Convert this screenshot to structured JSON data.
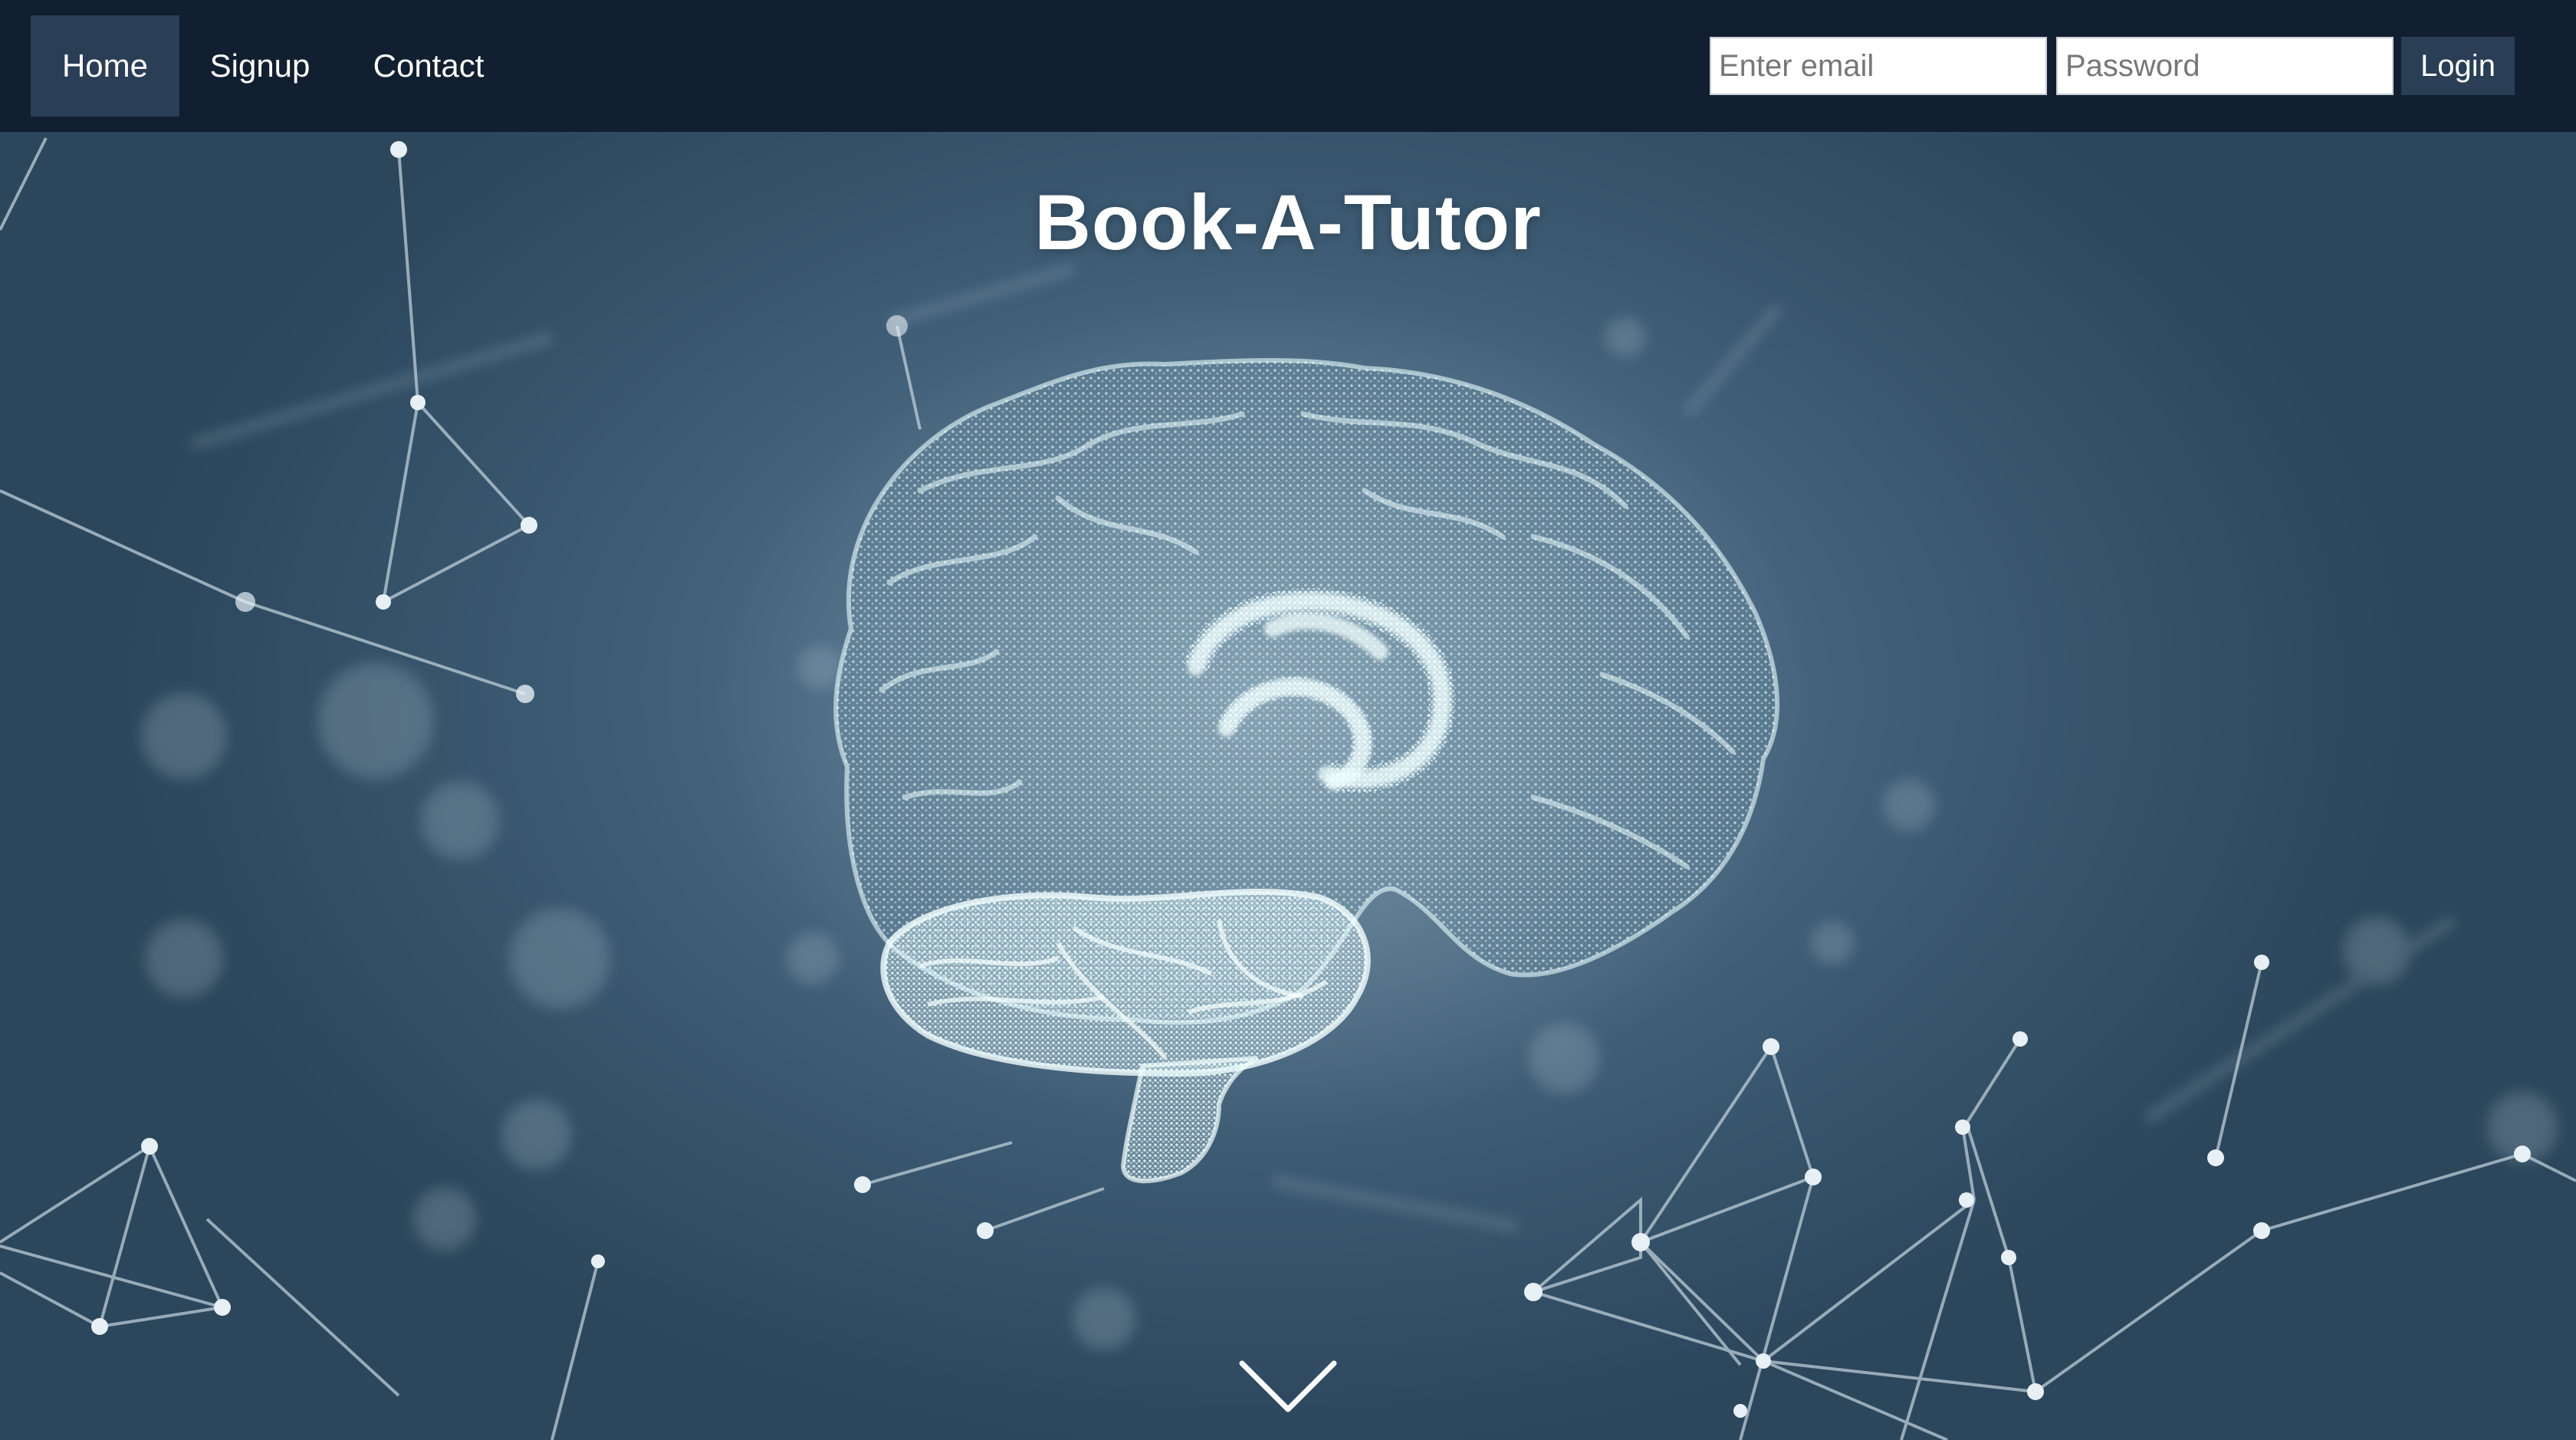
{
  "navbar": {
    "items": [
      {
        "label": "Home",
        "active": true
      },
      {
        "label": "Signup",
        "active": false
      },
      {
        "label": "Contact",
        "active": false
      }
    ],
    "login_form": {
      "email_placeholder": "Enter email",
      "password_placeholder": "Password",
      "login_label": "Login"
    }
  },
  "hero": {
    "title": "Book-A-Tutor",
    "background_image": "glowing-particle-brain-network",
    "scroll_icon": "chevron-down-icon"
  },
  "colors": {
    "navbar_bg": "#111f30",
    "nav_active_bg": "#2a3e55",
    "hero_bg": "#4b6b84",
    "brain_glow": "#d8f4f6"
  }
}
